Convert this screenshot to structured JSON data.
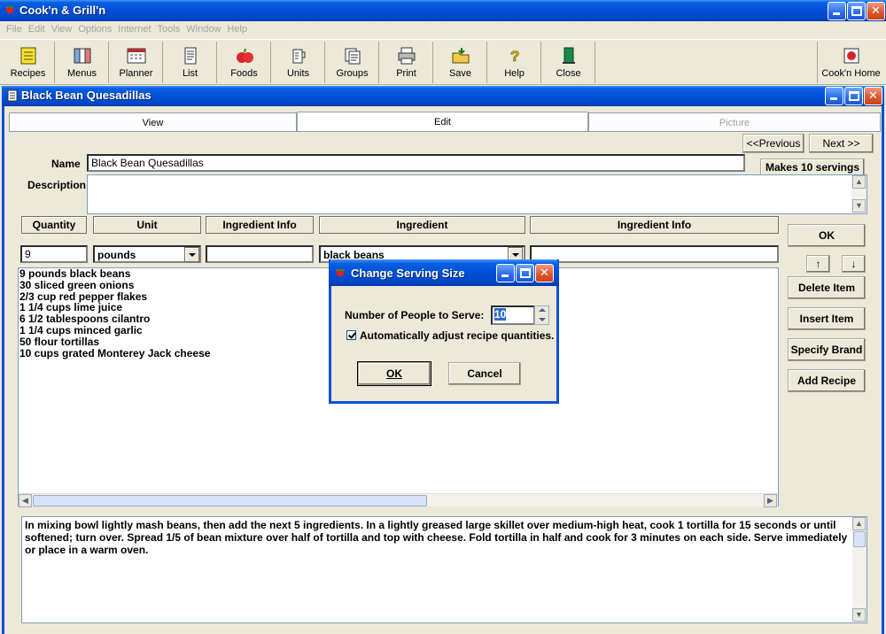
{
  "app": {
    "title": "Cook'n & Grill'n",
    "menu": [
      "File",
      "Edit",
      "View",
      "Options",
      "Internet",
      "Tools",
      "Window",
      "Help"
    ],
    "toolbar": [
      {
        "label": "Recipes",
        "icon": "recipes-icon"
      },
      {
        "label": "Menus",
        "icon": "menus-icon"
      },
      {
        "label": "Planner",
        "icon": "planner-icon"
      },
      {
        "label": "List",
        "icon": "list-icon"
      },
      {
        "label": "Foods",
        "icon": "foods-icon"
      },
      {
        "label": "Units",
        "icon": "units-icon"
      },
      {
        "label": "Groups",
        "icon": "groups-icon"
      },
      {
        "label": "Print",
        "icon": "print-icon"
      },
      {
        "label": "Save",
        "icon": "save-icon"
      },
      {
        "label": "Help",
        "icon": "help-icon"
      },
      {
        "label": "Close",
        "icon": "close-door-icon"
      }
    ],
    "home_label": "Cook'n Home"
  },
  "recipe_window": {
    "title": "Black Bean Quesadillas",
    "tabs": [
      "View",
      "Edit",
      "Picture"
    ],
    "prev_label": "<<Previous",
    "next_label": "Next >>",
    "name_label": "Name",
    "name_value": "Black Bean Quesadillas",
    "servings_label": "Makes 10 servings",
    "description_label": "Description",
    "description_value": "",
    "columns": [
      "Quantity",
      "Unit",
      "Ingredient Info",
      "Ingredient",
      "Ingredient Info"
    ],
    "entry": {
      "quantity": "9",
      "unit": "pounds",
      "info1": "",
      "ingredient": "black beans",
      "info2": ""
    },
    "ingredients": [
      "9 pounds black beans",
      "30 sliced green onions",
      "2/3 cup red pepper flakes",
      "1 1/4 cups lime juice",
      "6 1/2 tablespoons cilantro",
      "1 1/4 cups minced garlic",
      "50 flour tortillas",
      "10 cups grated Monterey Jack cheese"
    ],
    "side_buttons": {
      "ok": "OK",
      "up": "↑",
      "down": "↓",
      "delete": "Delete Item",
      "insert": "Insert Item",
      "brand": "Specify Brand",
      "add_recipe": "Add Recipe"
    },
    "directions": "In mixing bowl lightly mash beans, then add the next 5 ingredients. In a lightly greased large skillet over medium-high heat, cook 1 tortilla for 15 seconds or until softened; turn over. Spread 1/5 of bean mixture over half of tortilla and top with cheese. Fold tortilla in half and cook for 3 minutes on each side. Serve immediately or place in a warm oven."
  },
  "dialog": {
    "title": "Change Serving Size",
    "people_label": "Number of People to Serve:",
    "people_value": "10",
    "auto_adjust_label": "Automatically adjust recipe quantities.",
    "auto_adjust_checked": true,
    "ok_label": "OK",
    "cancel_label": "Cancel"
  }
}
